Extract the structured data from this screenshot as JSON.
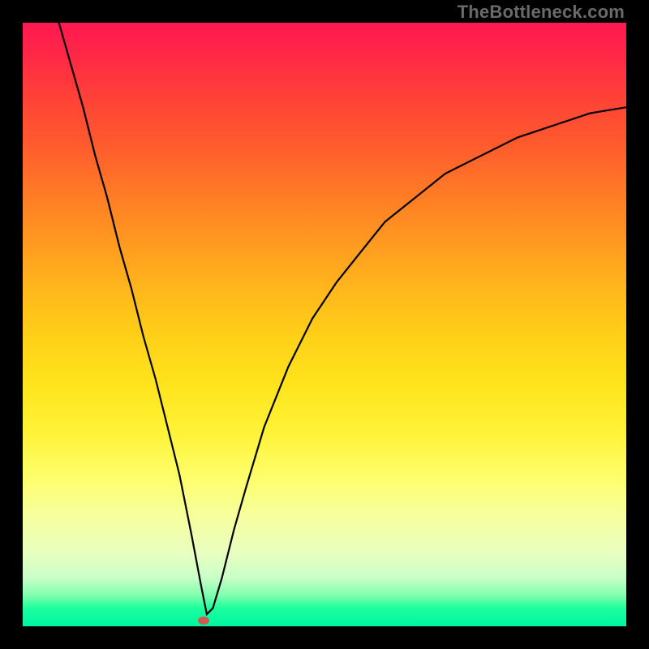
{
  "watermark": "TheBottleneck.com",
  "colors": {
    "frame": "#000000",
    "curve": "#000000",
    "dot": "#cf5a52"
  },
  "chart_data": {
    "type": "line",
    "title": "",
    "xlabel": "",
    "ylabel": "",
    "xlim": [
      0,
      100
    ],
    "ylim": [
      0,
      100
    ],
    "grid": false,
    "series": [
      {
        "name": "bottleneck-curve",
        "x": [
          6,
          8,
          10,
          12,
          14,
          16,
          18,
          20,
          22,
          24,
          26,
          28,
          29.5,
          30.5,
          31.5,
          33,
          35,
          37,
          40,
          44,
          48,
          52,
          56,
          60,
          65,
          70,
          76,
          82,
          88,
          94,
          100
        ],
        "y": [
          100,
          93,
          86,
          78,
          71,
          63,
          56,
          48,
          41,
          33,
          25,
          15,
          7,
          2,
          3,
          8,
          16,
          23,
          33,
          43,
          51,
          57,
          62,
          67,
          71,
          75,
          78,
          81,
          83,
          85,
          86
        ]
      }
    ],
    "marker": {
      "x": 30,
      "y": 1
    },
    "notes": "Values are approximate, read off the chart area; axes are unlabeled in the source image."
  }
}
